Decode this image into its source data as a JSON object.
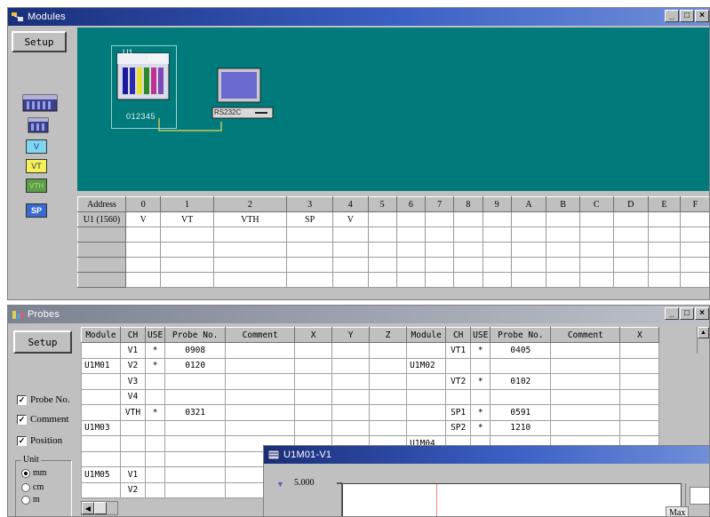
{
  "modules_window": {
    "title": "Modules",
    "setup_label": "Setup",
    "palette": {
      "v_label": "V",
      "vt_label": "VT",
      "vth_label": "VTH",
      "sp_label": "SP"
    },
    "diagram": {
      "unit_name": "U1",
      "unit_model": "1560",
      "unit_slots": "012345",
      "pc_port": "RS232C"
    },
    "grid": {
      "headers": [
        "Address",
        "0",
        "1",
        "2",
        "3",
        "4",
        "5",
        "6",
        "7",
        "8",
        "9",
        "A",
        "B",
        "C",
        "D",
        "E",
        "F"
      ],
      "rows": [
        [
          "U1 (1560)",
          "V",
          "VT",
          "VTH",
          "SP",
          "V",
          "",
          "",
          "",
          "",
          "",
          "",
          "",
          "",
          "",
          "",
          ""
        ]
      ]
    }
  },
  "probes_window": {
    "title": "Probes",
    "setup_label": "Setup",
    "headers": [
      "Module",
      "CH",
      "USE",
      "Probe No.",
      "Comment",
      "X",
      "Y",
      "Z",
      "Module",
      "CH",
      "USE",
      "Probe No.",
      "Comment",
      "X"
    ],
    "left_rows": [
      {
        "module": "",
        "ch": "V1",
        "use": "*",
        "probe": "0908"
      },
      {
        "module": "U1M01",
        "ch": "V2",
        "use": "*",
        "probe": "0120"
      },
      {
        "module": "",
        "ch": "V3",
        "use": "",
        "probe": ""
      },
      {
        "module": "",
        "ch": "V4",
        "use": "",
        "probe": ""
      },
      {
        "module": "",
        "ch": "VTH",
        "use": "*",
        "probe": "0321"
      },
      {
        "module": "U1M03",
        "ch": "",
        "use": "",
        "probe": ""
      },
      {
        "module": "",
        "ch": "",
        "use": "",
        "probe": ""
      },
      {
        "module": "",
        "ch": "",
        "use": "",
        "probe": ""
      },
      {
        "module": "U1M05",
        "ch": "V1",
        "use": "",
        "probe": ""
      },
      {
        "module": "",
        "ch": "V2",
        "use": "",
        "probe": ""
      }
    ],
    "right_rows": [
      {
        "module": "",
        "ch": "VT1",
        "use": "*",
        "probe": "0405"
      },
      {
        "module": "U1M02",
        "ch": "",
        "use": "",
        "probe": ""
      },
      {
        "module": "",
        "ch": "VT2",
        "use": "*",
        "probe": "0102"
      },
      {
        "module": "",
        "ch": "",
        "use": "",
        "probe": ""
      },
      {
        "module": "",
        "ch": "SP1",
        "use": "*",
        "probe": "0591"
      },
      {
        "module": "",
        "ch": "SP2",
        "use": "*",
        "probe": "1210"
      },
      {
        "module": "U1M04",
        "ch": "",
        "use": "",
        "probe": ""
      }
    ],
    "options": {
      "probe_no_label": "Probe No.",
      "comment_label": "Comment",
      "position_label": "Position",
      "probe_no_checked": true,
      "comment_checked": true,
      "position_checked": true
    },
    "unit": {
      "legend": "Unit",
      "mm": "mm",
      "cm": "cm",
      "m": "m",
      "selected": "mm"
    }
  },
  "graph_window": {
    "title": "U1M01-V1",
    "y_value": "5.000",
    "side_label": "Max"
  },
  "colors": {
    "canvas": "#007a7a",
    "title_active": "#1a2f7a",
    "face": "#c0c0c0"
  }
}
